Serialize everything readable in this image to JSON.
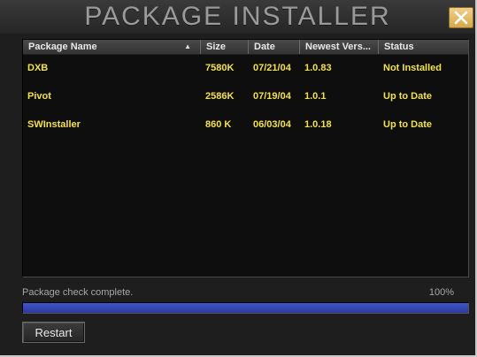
{
  "window": {
    "title": "PACKAGE INSTALLER"
  },
  "icons": {
    "close": "close-icon",
    "sort": "sort-ascending-icon"
  },
  "table": {
    "columns": [
      "Package Name",
      "Size",
      "Date",
      "Newest Vers...",
      "Status"
    ],
    "sort_indicator": "▲",
    "rows": [
      {
        "name": "DXB",
        "size": "7580K",
        "date": "07/21/04",
        "version": "1.0.83",
        "status": "Not Installed"
      },
      {
        "name": "Pivot",
        "size": "2586K",
        "date": "07/19/04",
        "version": "1.0.1",
        "status": "Up to Date"
      },
      {
        "name": "SWInstaller",
        "size": "860 K",
        "date": "06/03/04",
        "version": "1.0.18",
        "status": "Up to Date"
      }
    ]
  },
  "status": {
    "message": "Package check complete.",
    "percent_label": "100%",
    "progress": 1.0
  },
  "buttons": {
    "restart_label": "Restart"
  },
  "colors": {
    "row_text": "#f2e050",
    "progress_fill": "#3346b8",
    "close_button": "#e6bc64"
  }
}
